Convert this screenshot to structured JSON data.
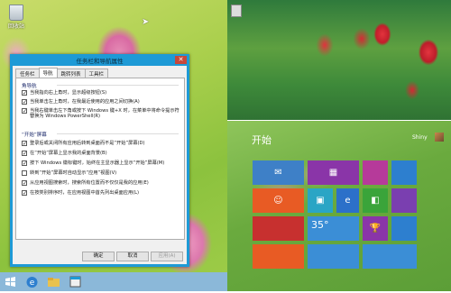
{
  "desktop": {
    "icon_label": "回收站"
  },
  "dialog": {
    "title": "任务栏和导航属性",
    "tabs": [
      {
        "label": "任务栏"
      },
      {
        "label": "导航"
      },
      {
        "label": "跳转列表"
      },
      {
        "label": "工具栏"
      }
    ],
    "active_tab": "导航",
    "corner_group_label": "角导航",
    "corner_options": [
      {
        "label": "当我指向右上角时，显示超级按钮(S)",
        "checked": true
      },
      {
        "label": "当我单击左上角时，在我最近使用的应用之间切换(A)",
        "checked": true
      },
      {
        "label": "当我右键单击左下角或按下 Windows 键+X 时，在菜单中将命令提示符替换为 Windows PowerShell(R)",
        "checked": true
      }
    ],
    "start_group_label": "“开始”屏幕",
    "start_options": [
      {
        "label": "登录后或关闭所有应用后转到桌面而不是“开始”屏幕(D)",
        "checked": true
      },
      {
        "label": "在“开始”屏幕上显示我的桌面背景(B)",
        "checked": true
      },
      {
        "label": "按下 Windows 徽标键时，始终在主显示器上显示“开始”屏幕(M)",
        "checked": true
      },
      {
        "label": "转到“开始”屏幕时自动显示“应用”视图(V)",
        "checked": false
      },
      {
        "label": "从应用视图搜索时，搜索所有位置而不仅仅是我的应用(E)",
        "checked": true
      },
      {
        "label": "在按类别排序时，在应用视图中首先列出桌面应用(L)",
        "checked": true
      }
    ],
    "buttons": {
      "ok": "确定",
      "cancel": "取消",
      "apply": "应用(A)"
    }
  },
  "start_screen": {
    "title": "开始",
    "user_name": "Shiny",
    "tiles": [
      {
        "name": "mail",
        "icon": "✉",
        "color": "#3e80c7"
      },
      {
        "name": "calendar",
        "icon": "▦",
        "color": "#8a35a8"
      },
      {
        "name": "tile-3",
        "icon": "",
        "color": "#b63a9a"
      },
      {
        "name": "tile-4",
        "icon": "",
        "color": "#2d7fcf"
      },
      {
        "name": "people",
        "icon": "☺",
        "color": "#e85b24"
      },
      {
        "name": "photos",
        "icon": "▣",
        "color": "#2aa5c5"
      },
      {
        "name": "ie",
        "icon": "e",
        "color": "#2c70c9"
      },
      {
        "name": "store",
        "icon": "◧",
        "color": "#3aa43a"
      },
      {
        "name": "tile-9",
        "icon": "",
        "color": "#7a3fb0"
      },
      {
        "name": "tile-10",
        "icon": "",
        "color": "#c7302f"
      },
      {
        "name": "weather",
        "icon": "",
        "color": "#3b8ed6"
      },
      {
        "name": "trophy",
        "icon": "🏆",
        "color": "#8a35a8"
      },
      {
        "name": "tile-13",
        "icon": "",
        "color": "#2d7fcf"
      },
      {
        "name": "tile-14",
        "icon": "",
        "color": "#e85b24"
      }
    ],
    "weather_temp": "35°"
  },
  "taskbar": {
    "items": [
      {
        "name": "start-button-icon"
      },
      {
        "name": "ie-icon"
      },
      {
        "name": "file-explorer-icon"
      },
      {
        "name": "settings-icon"
      }
    ]
  },
  "colors": {
    "dialog_frame": "#1e9ad6",
    "close_button": "#c7473b",
    "taskbar": "#8bb8d9",
    "start_bg": "#6aaa3e"
  }
}
